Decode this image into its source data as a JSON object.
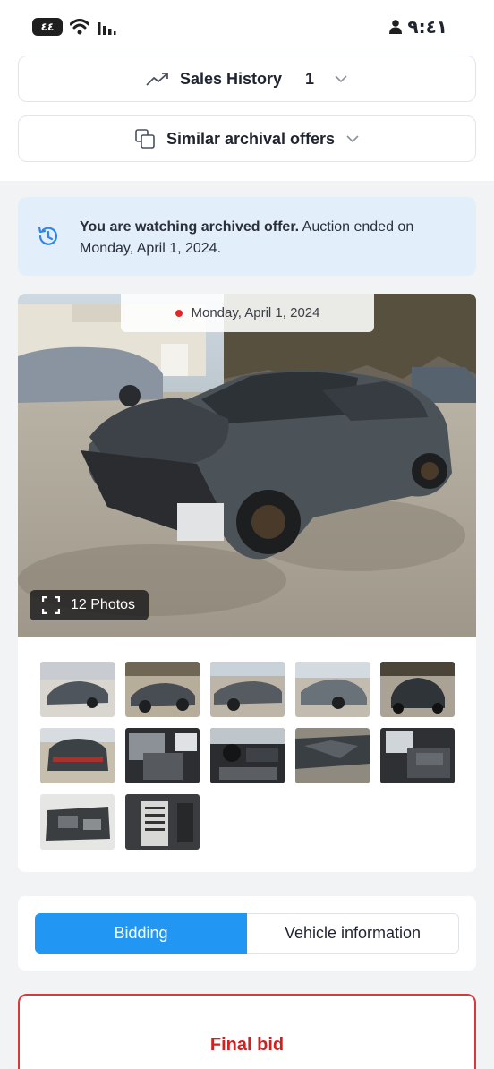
{
  "status_bar": {
    "battery_label": "٤٤",
    "time": "٩:٤١"
  },
  "header": {
    "sales_history_label": "Sales History",
    "sales_history_count": "1",
    "similar_offers_label": "Similar archival offers"
  },
  "notice": {
    "bold_text": "You are watching archived offer.",
    "text": " Auction ended on Monday, April 1, 2024."
  },
  "gallery": {
    "date_label": "Monday, April 1, 2024",
    "photos_label": "12 Photos",
    "thumbnails": [
      "front-left-damage",
      "rear-left",
      "left-side",
      "front-right",
      "front",
      "rear",
      "interior-front",
      "dashboard",
      "hood-damage",
      "rear-seats",
      "engine-bay",
      "vin-label"
    ]
  },
  "tabs": {
    "bidding": "Bidding",
    "vehicle_information": "Vehicle information"
  },
  "bid": {
    "final_bid_label": "Final bid"
  },
  "colors": {
    "accent": "#2196f3",
    "notice_bg": "#e3eefb",
    "danger": "#d41f1f"
  }
}
